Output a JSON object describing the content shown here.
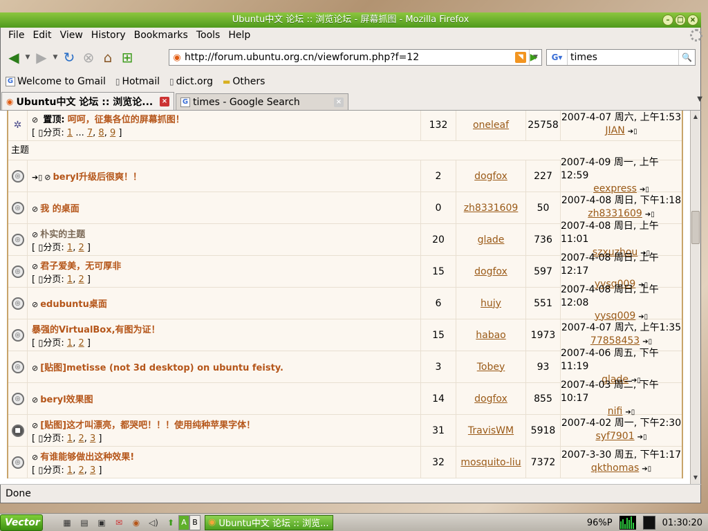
{
  "window": {
    "title": "Ubuntu中文 论坛 :: 浏览论坛 - 屏幕抓图 - Mozilla Firefox"
  },
  "menu": [
    "File",
    "Edit",
    "View",
    "History",
    "Bookmarks",
    "Tools",
    "Help"
  ],
  "navbar": {
    "url": "http://forum.ubuntu.org.cn/viewforum.php?f=12",
    "search_value": "times"
  },
  "bookmarks": [
    {
      "label": "Welcome to Gmail",
      "icon": "google-icon"
    },
    {
      "label": "Hotmail",
      "icon": "page-icon"
    },
    {
      "label": "dict.org",
      "icon": "page-icon"
    },
    {
      "label": "Others",
      "icon": "folder-icon"
    }
  ],
  "tabs": [
    {
      "label": "Ubuntu中文 论坛 :: 浏览论...",
      "active": true
    },
    {
      "label": "times - Google Search",
      "active": false
    }
  ],
  "forum": {
    "sticky": {
      "prefix": "置顶:",
      "title": "呵呵，征集各位的屏幕抓图！",
      "pages_label": "分页:",
      "pages": [
        "1",
        "...",
        "7",
        "8",
        "9"
      ],
      "replies": "132",
      "author": "oneleaf",
      "views": "25758",
      "last_time": "2007-4-07 周六, 上午1:53",
      "last_user": "JIAN"
    },
    "section_header": "主题",
    "topics": [
      {
        "title": "beryl升级后很爽！！",
        "moved": true,
        "pages": [],
        "replies": "2",
        "author": "dogfox",
        "views": "227",
        "last_time": "2007-4-09 周一, 上午12:59",
        "last_user": "eexpress",
        "locked": false
      },
      {
        "title": "我 的桌面",
        "moved": false,
        "pages": [],
        "replies": "0",
        "author": "zh8331609",
        "views": "50",
        "last_time": "2007-4-08 周日, 下午1:18",
        "last_user": "zh8331609",
        "locked": false
      },
      {
        "title": "朴实的主题",
        "moved": false,
        "gray": true,
        "pages": [
          "1",
          "2"
        ],
        "replies": "20",
        "author": "glade",
        "views": "736",
        "last_time": "2007-4-08 周日, 上午11:01",
        "last_user": "szxuzhou",
        "locked": false
      },
      {
        "title": "君子爱美，无可厚非",
        "moved": false,
        "pages": [
          "1",
          "2"
        ],
        "replies": "15",
        "author": "dogfox",
        "views": "597",
        "last_time": "2007-4-08 周日, 上午12:17",
        "last_user": "yysq009",
        "locked": false
      },
      {
        "title": "edubuntu桌面",
        "moved": false,
        "pages": [],
        "replies": "6",
        "author": "hujy",
        "views": "551",
        "last_time": "2007-4-08 周日, 上午12:08",
        "last_user": "yysq009",
        "locked": false
      },
      {
        "title": "暴强的VirtualBox,有图为证！",
        "moved": false,
        "noclip": true,
        "pages": [
          "1",
          "2"
        ],
        "replies": "15",
        "author": "habao",
        "views": "1973",
        "last_time": "2007-4-07 周六, 上午1:35",
        "last_user": "77858453",
        "locked": false
      },
      {
        "title": "[贴图]metisse (not 3d desktop) on ubuntu feisty.",
        "moved": false,
        "pages": [],
        "replies": "3",
        "author": "Tobey",
        "views": "93",
        "last_time": "2007-4-06 周五, 下午11:19",
        "last_user": "glade",
        "locked": false
      },
      {
        "title": "beryl效果图",
        "moved": false,
        "pages": [],
        "replies": "14",
        "author": "dogfox",
        "views": "855",
        "last_time": "2007-4-03 周二, 下午10:17",
        "last_user": "nifi",
        "locked": false
      },
      {
        "title": "[贴图]这才叫漂亮，都哭吧！！！使用纯种苹果字体！",
        "moved": false,
        "pages": [
          "1",
          "2",
          "3"
        ],
        "replies": "31",
        "author": "TravisWM",
        "views": "5918",
        "last_time": "2007-4-02 周一, 下午2:30",
        "last_user": "syf7901",
        "locked": true
      },
      {
        "title": "有谁能够做出这种效果!",
        "moved": false,
        "pages": [
          "1",
          "2",
          "3"
        ],
        "replies": "32",
        "author": "mosquito-liu",
        "views": "7372",
        "last_time": "2007-3-30 周五, 下午1:17",
        "last_user": "qkthomas",
        "locked": false
      }
    ]
  },
  "status": "Done",
  "taskbar": {
    "start_label": "Vector",
    "task_label": "Ubuntu中文 论坛 :: 浏览...",
    "workspaces": [
      "A",
      "B"
    ],
    "battery": "96%P",
    "clock": "01:30:20"
  }
}
